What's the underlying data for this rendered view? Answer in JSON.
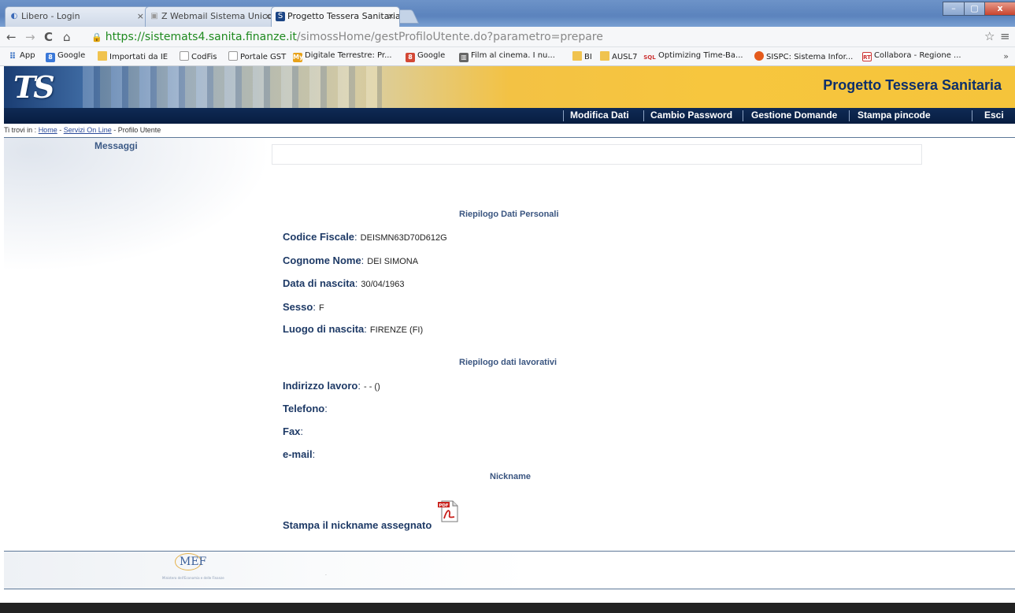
{
  "browser": {
    "tabs": [
      {
        "label": "Libero - Login",
        "icon": "libero-icon"
      },
      {
        "label": "Z Webmail Sistema Unico P",
        "icon": "zimbra-icon"
      },
      {
        "label": "Progetto Tessera Sanitaria",
        "icon": "ts-icon"
      }
    ],
    "tab_close": "×",
    "window_controls": {
      "minimize": "–",
      "maximize": "▢",
      "close": "x"
    },
    "nav": {
      "back": "←",
      "forward": "→",
      "reload": "C",
      "home": "⌂"
    },
    "url": {
      "secure_part": "https://sistemats4.sanita.finanze.it",
      "path_part": "/simossHome/gestProfiloUtente.do?parametro=prepare"
    },
    "star": "☆",
    "menu": "≡",
    "bookmarks": [
      {
        "label": "App",
        "icon": "apps-icon"
      },
      {
        "label": "Google",
        "icon": "google-icon"
      },
      {
        "label": "Importati da IE",
        "icon": "folder-icon"
      },
      {
        "label": "CodFis",
        "icon": "page-icon"
      },
      {
        "label": "Portale GST",
        "icon": "portal-icon"
      },
      {
        "label": "Digitale Terrestre: Pr...",
        "icon": "my-icon"
      },
      {
        "label": "Google",
        "icon": "google-plus-icon"
      },
      {
        "label": "Film al cinema. I nu...",
        "icon": "film-icon"
      },
      {
        "label": "BI",
        "icon": "folder-icon"
      },
      {
        "label": "AUSL7",
        "icon": "folder-icon"
      },
      {
        "label": "Optimizing Time-Ba...",
        "icon": "sql-icon"
      },
      {
        "label": "SISPC: Sistema Infor...",
        "icon": "sispc-icon"
      },
      {
        "label": "Collabora - Regione ...",
        "icon": "rt-icon"
      }
    ],
    "bookmarks_more": "»"
  },
  "header": {
    "logo": "TS",
    "title": "Progetto Tessera Sanitaria",
    "menu": [
      "Modifica Dati",
      "Cambio Password",
      "Gestione Domande",
      "Stampa pincode",
      "Esci"
    ]
  },
  "breadcrumb": {
    "prefix": "Ti trovi in : ",
    "home": "Home",
    "sep1": " - ",
    "servizi": "Servizi On Line",
    "sep2": " - ",
    "current": "Profilo Utente"
  },
  "messaggi": {
    "label": "Messaggi"
  },
  "personal": {
    "title": "Riepilogo Dati Personali",
    "fields": [
      {
        "label": "Codice Fiscale",
        "value": "DEISMN63D70D612G"
      },
      {
        "label": "Cognome Nome",
        "value": "DEI SIMONA"
      },
      {
        "label": "Data di nascita",
        "value": "30/04/1963"
      },
      {
        "label": "Sesso",
        "value": "F"
      },
      {
        "label": "Luogo di nascita",
        "value": "FIRENZE (FI)"
      }
    ]
  },
  "work": {
    "title": "Riepilogo dati lavorativi",
    "fields": [
      {
        "label": "Indirizzo lavoro",
        "value": "- - ()"
      },
      {
        "label": "Telefono",
        "value": ""
      },
      {
        "label": "Fax",
        "value": ""
      },
      {
        "label": "e-mail",
        "value": ""
      }
    ]
  },
  "nickname": {
    "title": "Nickname",
    "pdf_label": "PDF",
    "print_label": "Stampa il nickname assegnato"
  },
  "footer": {
    "logo": "MEF",
    "subtitle": "Ministero dell'Economia e delle Finanze",
    "dot": "."
  },
  "colors": {
    "navy": "#0d2f6b",
    "menubar": "#071d40",
    "banner_yellow": "#f5c43b",
    "label_blue": "#1e3a66"
  }
}
